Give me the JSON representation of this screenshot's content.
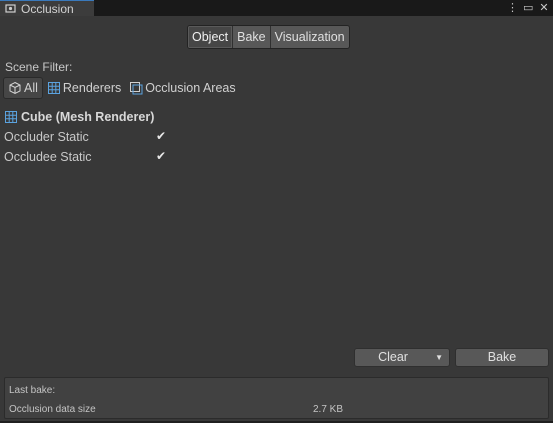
{
  "window": {
    "tab_title": "Occlusion",
    "tab_icon": "occlusion-camera-icon",
    "controls": [
      "more-menu-icon",
      "maximize-icon",
      "close-icon"
    ]
  },
  "toolbar": {
    "modes": [
      "Object",
      "Bake",
      "Visualization"
    ],
    "active_mode": "Object"
  },
  "scene_filter": {
    "label": "Scene Filter:",
    "options": [
      {
        "label": "All",
        "icon": "cube-icon",
        "active": true
      },
      {
        "label": "Renderers",
        "icon": "mesh-renderer-icon",
        "active": false
      },
      {
        "label": "Occlusion Areas",
        "icon": "occlusion-area-icon",
        "active": false
      }
    ]
  },
  "object": {
    "title": "Cube (Mesh Renderer)",
    "properties": [
      {
        "label": "Occluder Static",
        "checked": true
      },
      {
        "label": "Occludee Static",
        "checked": true
      }
    ]
  },
  "actions": {
    "clear_label": "Clear",
    "bake_label": "Bake"
  },
  "info": {
    "last_bake_label": "Last bake:",
    "data_size_label": "Occlusion data size",
    "data_size_value": "2.7 KB"
  },
  "colors": {
    "background": "#383838",
    "tab_accent": "#3a79bb",
    "icon_accent": "#5ba3e0"
  }
}
